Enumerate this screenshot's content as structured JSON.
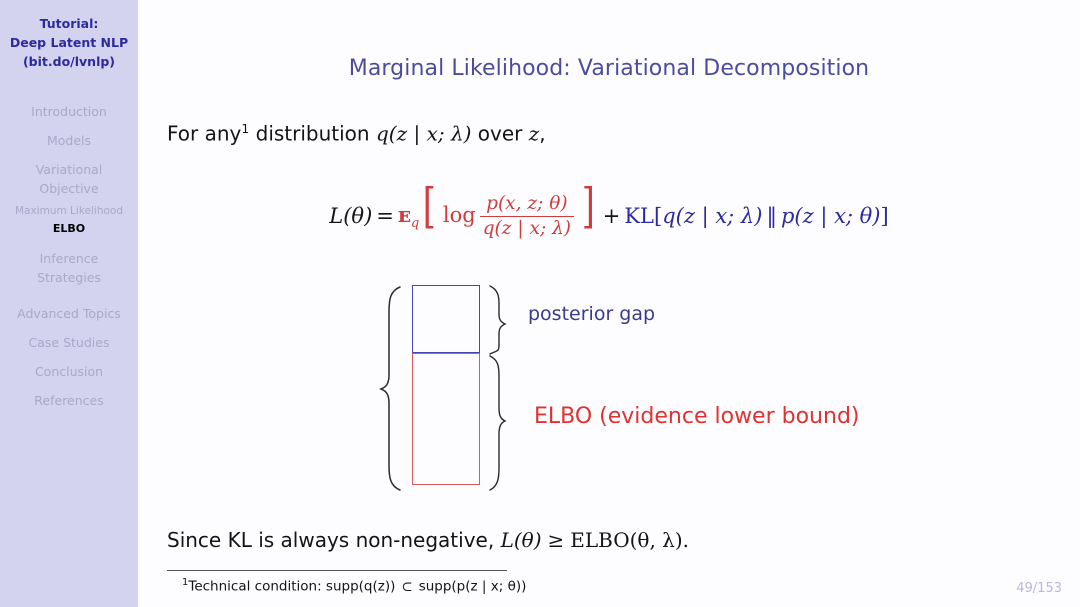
{
  "sidebar": {
    "title_lines": [
      "Tutorial:",
      "Deep Latent NLP",
      "(bit.do/lvnlp)"
    ],
    "title_color": "#2b2b9e",
    "background": "#d3d2ef",
    "items": [
      {
        "label": "Introduction",
        "level": "section",
        "active": false
      },
      {
        "label": "Models",
        "level": "section",
        "active": false
      },
      {
        "label": "Variational",
        "level": "section",
        "active": false
      },
      {
        "label": "Objective",
        "level": "section-cont",
        "active": false
      },
      {
        "label": "Maximum Likelihood",
        "level": "subsection",
        "active": false
      },
      {
        "label": "ELBO",
        "level": "subsection",
        "active": true
      },
      {
        "label": "Inference",
        "level": "section",
        "active": false
      },
      {
        "label": "Strategies",
        "level": "section-cont",
        "active": false
      },
      {
        "label": "Advanced Topics",
        "level": "section",
        "active": false
      },
      {
        "label": "Case Studies",
        "level": "section",
        "active": false
      },
      {
        "label": "Conclusion",
        "level": "section",
        "active": false
      },
      {
        "label": "References",
        "level": "section",
        "active": false
      }
    ]
  },
  "slide": {
    "title": "Marginal Likelihood: Variational Decomposition",
    "title_color": "#4c4c9e",
    "intro": {
      "prefix": "For any",
      "footnote_mark": "1",
      "middle": " distribution ",
      "math_q": "q(z | x; λ)",
      "suffix": " over ",
      "math_z": "z",
      "end": ","
    },
    "equation": {
      "lhs": "L(θ)",
      "equals": "=",
      "elbo": {
        "color": "#d13b3b",
        "expectation": "ᴇ",
        "expectation_sub": "q",
        "log": "log",
        "numerator": "p(x, z; θ)",
        "denominator": "q(z | x; λ)",
        "bracket_open": "[",
        "bracket_close": "]"
      },
      "plus": "+",
      "kl": {
        "color": "#2b2b9e",
        "name": "KL",
        "open": "[",
        "left_dist": "q(z | x; λ)",
        "separator": "‖",
        "right_dist": "p(z | x; θ)",
        "close": "]"
      }
    },
    "diagram": {
      "gap_box": {
        "label": "posterior gap",
        "color": "#4646b4",
        "label_color": "#3a3a8c"
      },
      "elbo_box": {
        "label": "ELBO (evidence lower bound)",
        "color": "#d85a5a",
        "label_color": "#e03232"
      },
      "left_brace": "{",
      "right_brace_top": "}",
      "right_brace_bottom": "}"
    },
    "conclusion": {
      "text": "Since KL is always non-negative, ",
      "math_lhs": "L(θ)",
      "relation": "≥",
      "math_rhs": "ELBO(θ, λ)",
      "period": "."
    },
    "footnote": {
      "mark": "1",
      "text_before": "Technical condition:  ",
      "supp_q": "supp(q(z))",
      "subset": "⊂",
      "supp_p": "supp(p(z | x; θ))"
    },
    "page_number": "49/153"
  }
}
